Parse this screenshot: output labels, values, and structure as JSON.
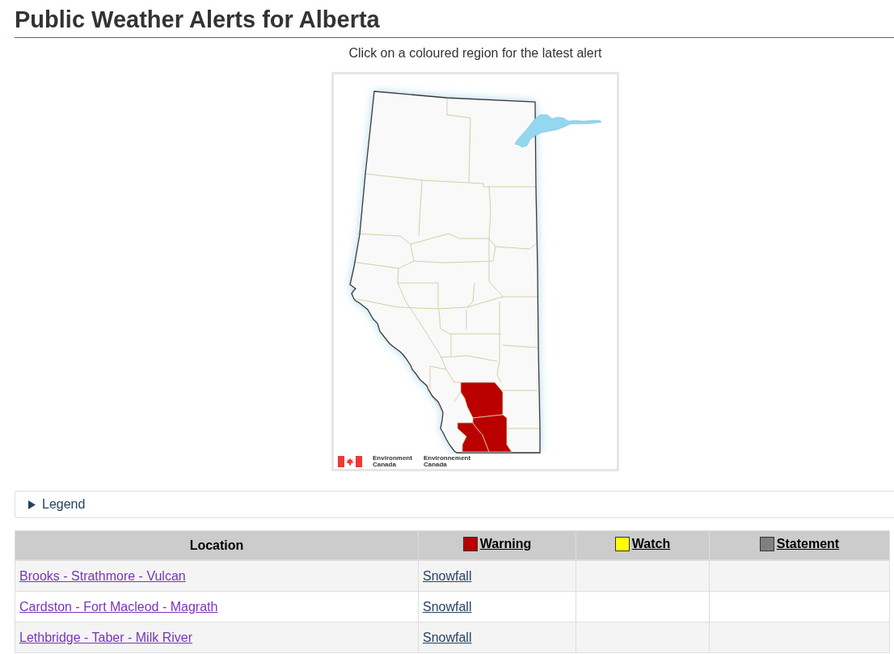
{
  "page": {
    "title": "Public Weather Alerts for Alberta"
  },
  "map": {
    "caption": "Click on a coloured region for the latest alert",
    "credit": [
      {
        "lines": [
          "Environment",
          "Canada"
        ]
      },
      {
        "lines": [
          "Environnement",
          "Canada"
        ]
      }
    ]
  },
  "legend": {
    "label": "Legend",
    "expanded": false
  },
  "table": {
    "columns": [
      {
        "kind": "location",
        "label": "Location"
      },
      {
        "kind": "warning",
        "label": "Warning",
        "color": "#bb0000"
      },
      {
        "kind": "watch",
        "label": "Watch",
        "color": "#ffff00"
      },
      {
        "kind": "statement",
        "label": "Statement",
        "color": "#808080"
      }
    ],
    "rows": [
      {
        "location": "Brooks - Strathmore - Vulcan",
        "visited": true,
        "alerts": [
          {
            "kind": "warning",
            "text": "Snowfall",
            "visited": false
          }
        ]
      },
      {
        "location": "Cardston - Fort Macleod - Magrath",
        "visited": true,
        "alerts": [
          {
            "kind": "warning",
            "text": "Snowfall",
            "visited": false
          }
        ]
      },
      {
        "location": "Lethbridge - Taber - Milk River",
        "visited": true,
        "alerts": [
          {
            "kind": "warning",
            "text": "Snowfall",
            "visited": false
          }
        ]
      }
    ]
  }
}
